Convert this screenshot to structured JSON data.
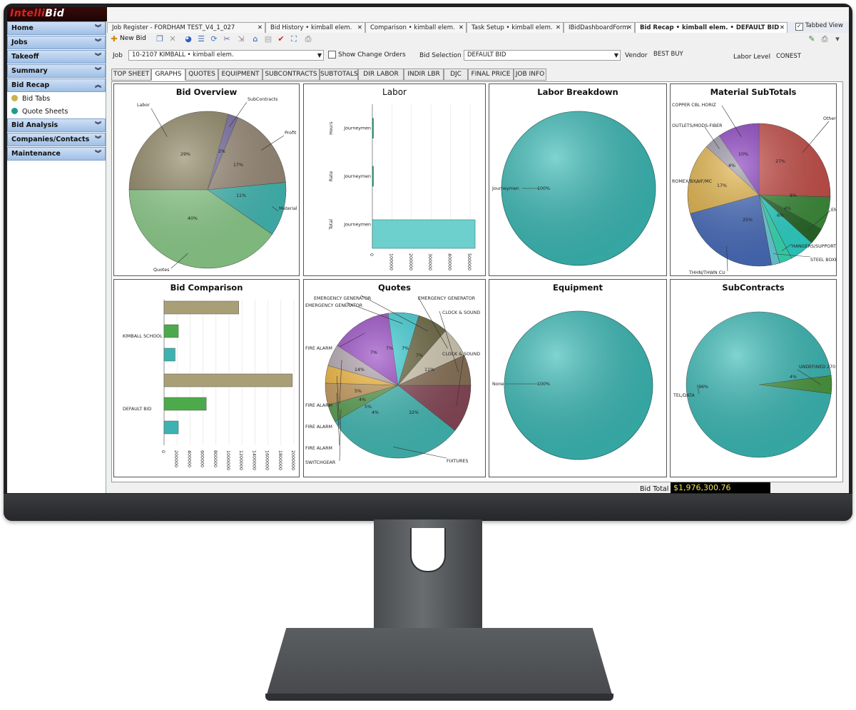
{
  "app": {
    "logo_a": "Intelli",
    "logo_b": "Bid"
  },
  "sidebar": {
    "sections": [
      {
        "label": "Home"
      },
      {
        "label": "Jobs"
      },
      {
        "label": "Takeoff"
      },
      {
        "label": "Summary"
      },
      {
        "label": "Bid Recap",
        "expanded": true
      }
    ],
    "sub_items": [
      {
        "label": "Bid Tabs",
        "color": "#c9b24a"
      },
      {
        "label": "Quote Sheets",
        "color": "#1f9b8f"
      }
    ],
    "sections_after": [
      {
        "label": "Bid Analysis"
      },
      {
        "label": "Companies/Contacts"
      },
      {
        "label": "Maintenance"
      }
    ]
  },
  "doc_tabs": [
    {
      "label": "Job Register - FORDHAM TEST_V4_1_027"
    },
    {
      "label": "Bid History • kimball elem."
    },
    {
      "label": "Comparison • kimball elem."
    },
    {
      "label": "Task Setup • kimball elem."
    },
    {
      "label": "IBidDashboardForm"
    },
    {
      "label": "Bid Recap • kimball elem. • DEFAULT BID",
      "active": true
    }
  ],
  "tabbed_view": "Tabbed View",
  "toolbar": {
    "new_bid": "New Bid"
  },
  "job": {
    "label": "Job",
    "value": "10-2107 KIMBALL • kimball elem.",
    "show_change_orders": "Show Change Orders",
    "bid_selection_label": "Bid Selection",
    "bid_selection": "DEFAULT BID",
    "vendor_label": "Vendor",
    "vendor": "BEST BUY",
    "labor_level_label": "Labor Level",
    "labor_level": "CONEST"
  },
  "sub_tabs": [
    "TOP SHEET",
    "GRAPHS",
    "QUOTES",
    "EQUIPMENT",
    "SUBCONTRACTS",
    "SUBTOTALS",
    "DIR LABOR",
    "INDIR LBR",
    "DJC",
    "FINAL PRICE",
    "JOB INFO"
  ],
  "bid_total": {
    "label": "Bid Total",
    "value": "$1,976,300.76"
  },
  "colors": {
    "teal": "#3cbcb8",
    "olive": "#8a7f5a",
    "green": "#7cc47a"
  },
  "chart_data": [
    {
      "type": "pie",
      "title": "Bid Overview",
      "slices": [
        {
          "label": "Labor",
          "value": 29,
          "color": "#8f8664"
        },
        {
          "label": "SubContracts",
          "value": 2,
          "color": "#7a6fa6"
        },
        {
          "label": "Profit",
          "value": 17,
          "color": "#9c8d7a"
        },
        {
          "label": "Material",
          "value": 11,
          "color": "#45bdb8"
        },
        {
          "label": "Quotes",
          "value": 40,
          "color": "#8fd08d"
        }
      ]
    },
    {
      "type": "bar",
      "title": "Labor",
      "orientation": "vertical",
      "axis_labels": [
        "Hours",
        "Rate",
        "Total"
      ],
      "categories": [
        "Journeymen",
        "Journeymen",
        "Journeymen"
      ],
      "values": [
        1000,
        0,
        520000
      ],
      "ticks": [
        "0",
        "100000",
        "200000",
        "300000",
        "400000",
        "500000"
      ]
    },
    {
      "type": "pie",
      "title": "Labor Breakdown",
      "slices": [
        {
          "label": "Journeymen",
          "value": 100,
          "color": "#3cbcb8"
        }
      ],
      "data_labels": [
        "100%"
      ]
    },
    {
      "type": "pie",
      "title": "Material SubTotals",
      "slices": [
        {
          "label": "Others",
          "value": 27,
          "color": "#c9504a"
        },
        {
          "label": "",
          "value": 8,
          "color": "#3e8f3c"
        },
        {
          "label": "EMT",
          "value": 4,
          "color": "#2a6b2a"
        },
        {
          "label": "",
          "value": 6,
          "color": "#2fd7cc"
        },
        {
          "label": "HANGERS/SUPPORTS",
          "value": 3,
          "color": "#38e0b8"
        },
        {
          "label": "STEEL BOXES",
          "value": 2,
          "color": "#6bd3e0"
        },
        {
          "label": "THHN/THWN CU",
          "value": 25,
          "color": "#4a6fbf"
        },
        {
          "label": "ROMEX/BX/UF/MC",
          "value": 17,
          "color": "#e3b449"
        },
        {
          "label": "OUTLETS/MODS-FIBER",
          "value": 4,
          "color": "#9a96a6"
        },
        {
          "label": "COPPER CBL HORIZ",
          "value": 10,
          "color": "#8a3fc1"
        }
      ],
      "data_labels": [
        "27%",
        "8%",
        "4%",
        "6%",
        "25%",
        "17%",
        "4%",
        "10%"
      ]
    },
    {
      "type": "bar",
      "title": "Bid Comparison",
      "orientation": "horizontal",
      "categories": [
        "KIMBALL SCHOOL",
        "DEFAULT BID"
      ],
      "series": [
        {
          "values": [
            1150000,
            1976300
          ],
          "color": "#a99f76"
        },
        {
          "values": [
            220000,
            650000
          ],
          "color": "#4caa4a"
        },
        {
          "values": [
            170000,
            220000
          ],
          "color": "#3cb3b0"
        }
      ],
      "ticks": [
        "0",
        "200000",
        "400000",
        "600000",
        "800000",
        "1000000",
        "1200000",
        "1400000",
        "1600000",
        "1800000",
        "2000000"
      ],
      "xlim": [
        0,
        2000000
      ]
    },
    {
      "type": "pie",
      "title": "Quotes",
      "slices": [
        {
          "label": "CLOCK & SOUND",
          "value": 11,
          "color": "#8a4a5a"
        },
        {
          "label": "FIXTURES",
          "value": 32,
          "color": "#45bdb8"
        },
        {
          "label": "SWITCHGEAR",
          "value": 4,
          "color": "#5aa050"
        },
        {
          "label": "FIRE ALARM",
          "value": 5,
          "color": "#c79a5a"
        },
        {
          "label": "FIRE ALARM",
          "value": 4,
          "color": "#f2b63a"
        },
        {
          "label": "FIRE ALARM",
          "value": 5,
          "color": "#b3a5b0"
        },
        {
          "label": "FIRE ALARM",
          "value": 14,
          "color": "#9747c4"
        },
        {
          "label": "EMERGENCY GENERATOR",
          "value": 7,
          "color": "#3fd2d8"
        },
        {
          "label": "EMERGENCY GENERATOR",
          "value": 7,
          "color": "#6d6a42"
        },
        {
          "label": "EMERGENCY GENERATOR",
          "value": 7,
          "color": "#d8cfb8"
        },
        {
          "label": "CLOCK & SOUND",
          "value": 7,
          "color": "#8c7358"
        }
      ],
      "data_labels": [
        "11%",
        "32%",
        "4%",
        "5%",
        "4%",
        "5%",
        "14%",
        "7%",
        "7%",
        "7%",
        "7%"
      ]
    },
    {
      "type": "pie",
      "title": "Equipment",
      "slices": [
        {
          "label": "None",
          "value": 100,
          "color": "#3cbcb8"
        }
      ],
      "data_labels": [
        "100%"
      ]
    },
    {
      "type": "pie",
      "title": "SubContracts",
      "slices": [
        {
          "label": "UNDEFINED 270",
          "value": 4,
          "color": "#4c9a40"
        },
        {
          "label": "TEL/DATA",
          "value": 96,
          "color": "#3cbcb8"
        }
      ],
      "data_labels": [
        "4%",
        "96%"
      ]
    }
  ]
}
